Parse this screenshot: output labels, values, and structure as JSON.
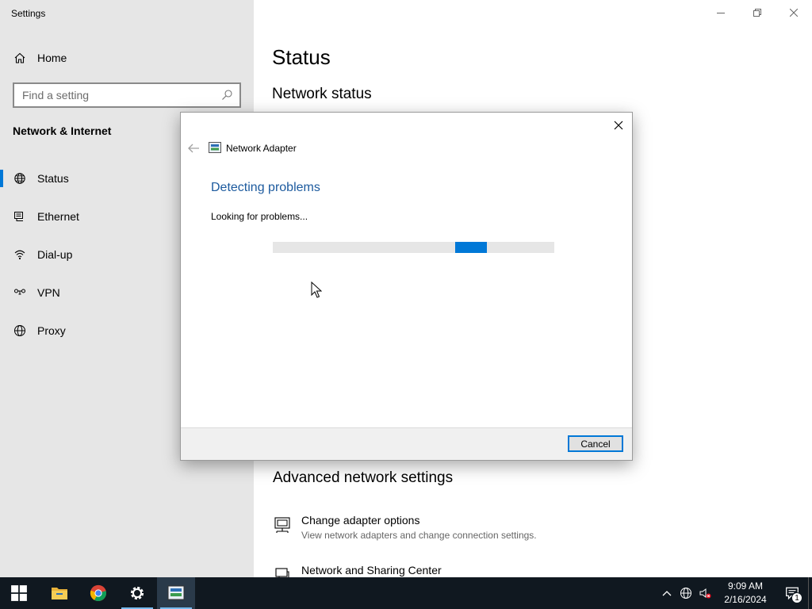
{
  "window": {
    "app_title": "Settings"
  },
  "sidebar": {
    "home_label": "Home",
    "search_placeholder": "Find a setting",
    "section_title": "Network & Internet",
    "items": [
      {
        "label": "Status",
        "icon": "globe-network-icon",
        "active": true
      },
      {
        "label": "Ethernet",
        "icon": "ethernet-icon",
        "active": false
      },
      {
        "label": "Dial-up",
        "icon": "dialup-icon",
        "active": false
      },
      {
        "label": "VPN",
        "icon": "vpn-icon",
        "active": false
      },
      {
        "label": "Proxy",
        "icon": "globe-icon",
        "active": false
      }
    ]
  },
  "main": {
    "page_title": "Status",
    "network_status_heading": "Network status",
    "advanced_heading": "Advanced network settings",
    "links": [
      {
        "title": "Change adapter options",
        "description": "View network adapters and change connection settings."
      },
      {
        "title": "Network and Sharing Center",
        "description": ""
      }
    ]
  },
  "dialog": {
    "app_name": "Network Adapter",
    "heading": "Detecting problems",
    "status": "Looking for problems...",
    "progress_fraction": 0.76,
    "cancel_label": "Cancel"
  },
  "taskbar": {
    "time": "9:09 AM",
    "date": "2/16/2024",
    "notification_count": "1"
  },
  "colors": {
    "accent": "#0078d7",
    "dialog_heading": "#1c5a9e",
    "sidebar_bg": "#e6e6e6",
    "taskbar_bg": "#101820"
  }
}
